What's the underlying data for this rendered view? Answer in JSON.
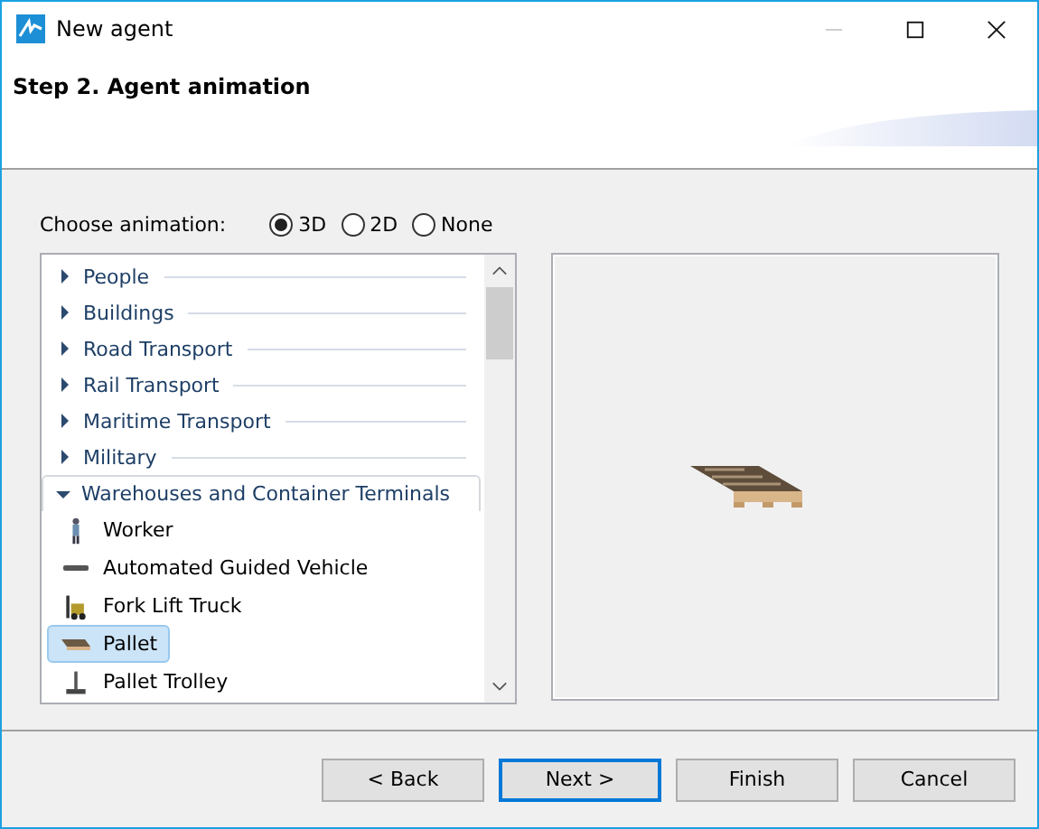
{
  "window": {
    "title": "New agent"
  },
  "header": {
    "step": "Step 2. Agent animation"
  },
  "animation": {
    "label": "Choose animation:",
    "options": [
      {
        "label": "3D",
        "selected": true
      },
      {
        "label": "2D",
        "selected": false
      },
      {
        "label": "None",
        "selected": false
      }
    ]
  },
  "tree": [
    {
      "label": "People",
      "expanded": false
    },
    {
      "label": "Buildings",
      "expanded": false
    },
    {
      "label": "Road Transport",
      "expanded": false
    },
    {
      "label": "Rail Transport",
      "expanded": false
    },
    {
      "label": "Maritime Transport",
      "expanded": false
    },
    {
      "label": "Military",
      "expanded": false
    },
    {
      "label": "Warehouses and Container Terminals",
      "expanded": true,
      "children": [
        {
          "label": "Worker",
          "kind": "worker",
          "selected": false
        },
        {
          "label": "Automated Guided Vehicle",
          "kind": "agv",
          "selected": false
        },
        {
          "label": "Fork Lift Truck",
          "kind": "forklift",
          "selected": false
        },
        {
          "label": "Pallet",
          "kind": "pallet",
          "selected": true
        },
        {
          "label": "Pallet Trolley",
          "kind": "trolley",
          "selected": false
        }
      ]
    }
  ],
  "buttons": [
    {
      "label": "< Back",
      "default": false
    },
    {
      "label": "Next >",
      "default": true
    },
    {
      "label": "Finish",
      "default": false
    },
    {
      "label": "Cancel",
      "default": false
    }
  ]
}
